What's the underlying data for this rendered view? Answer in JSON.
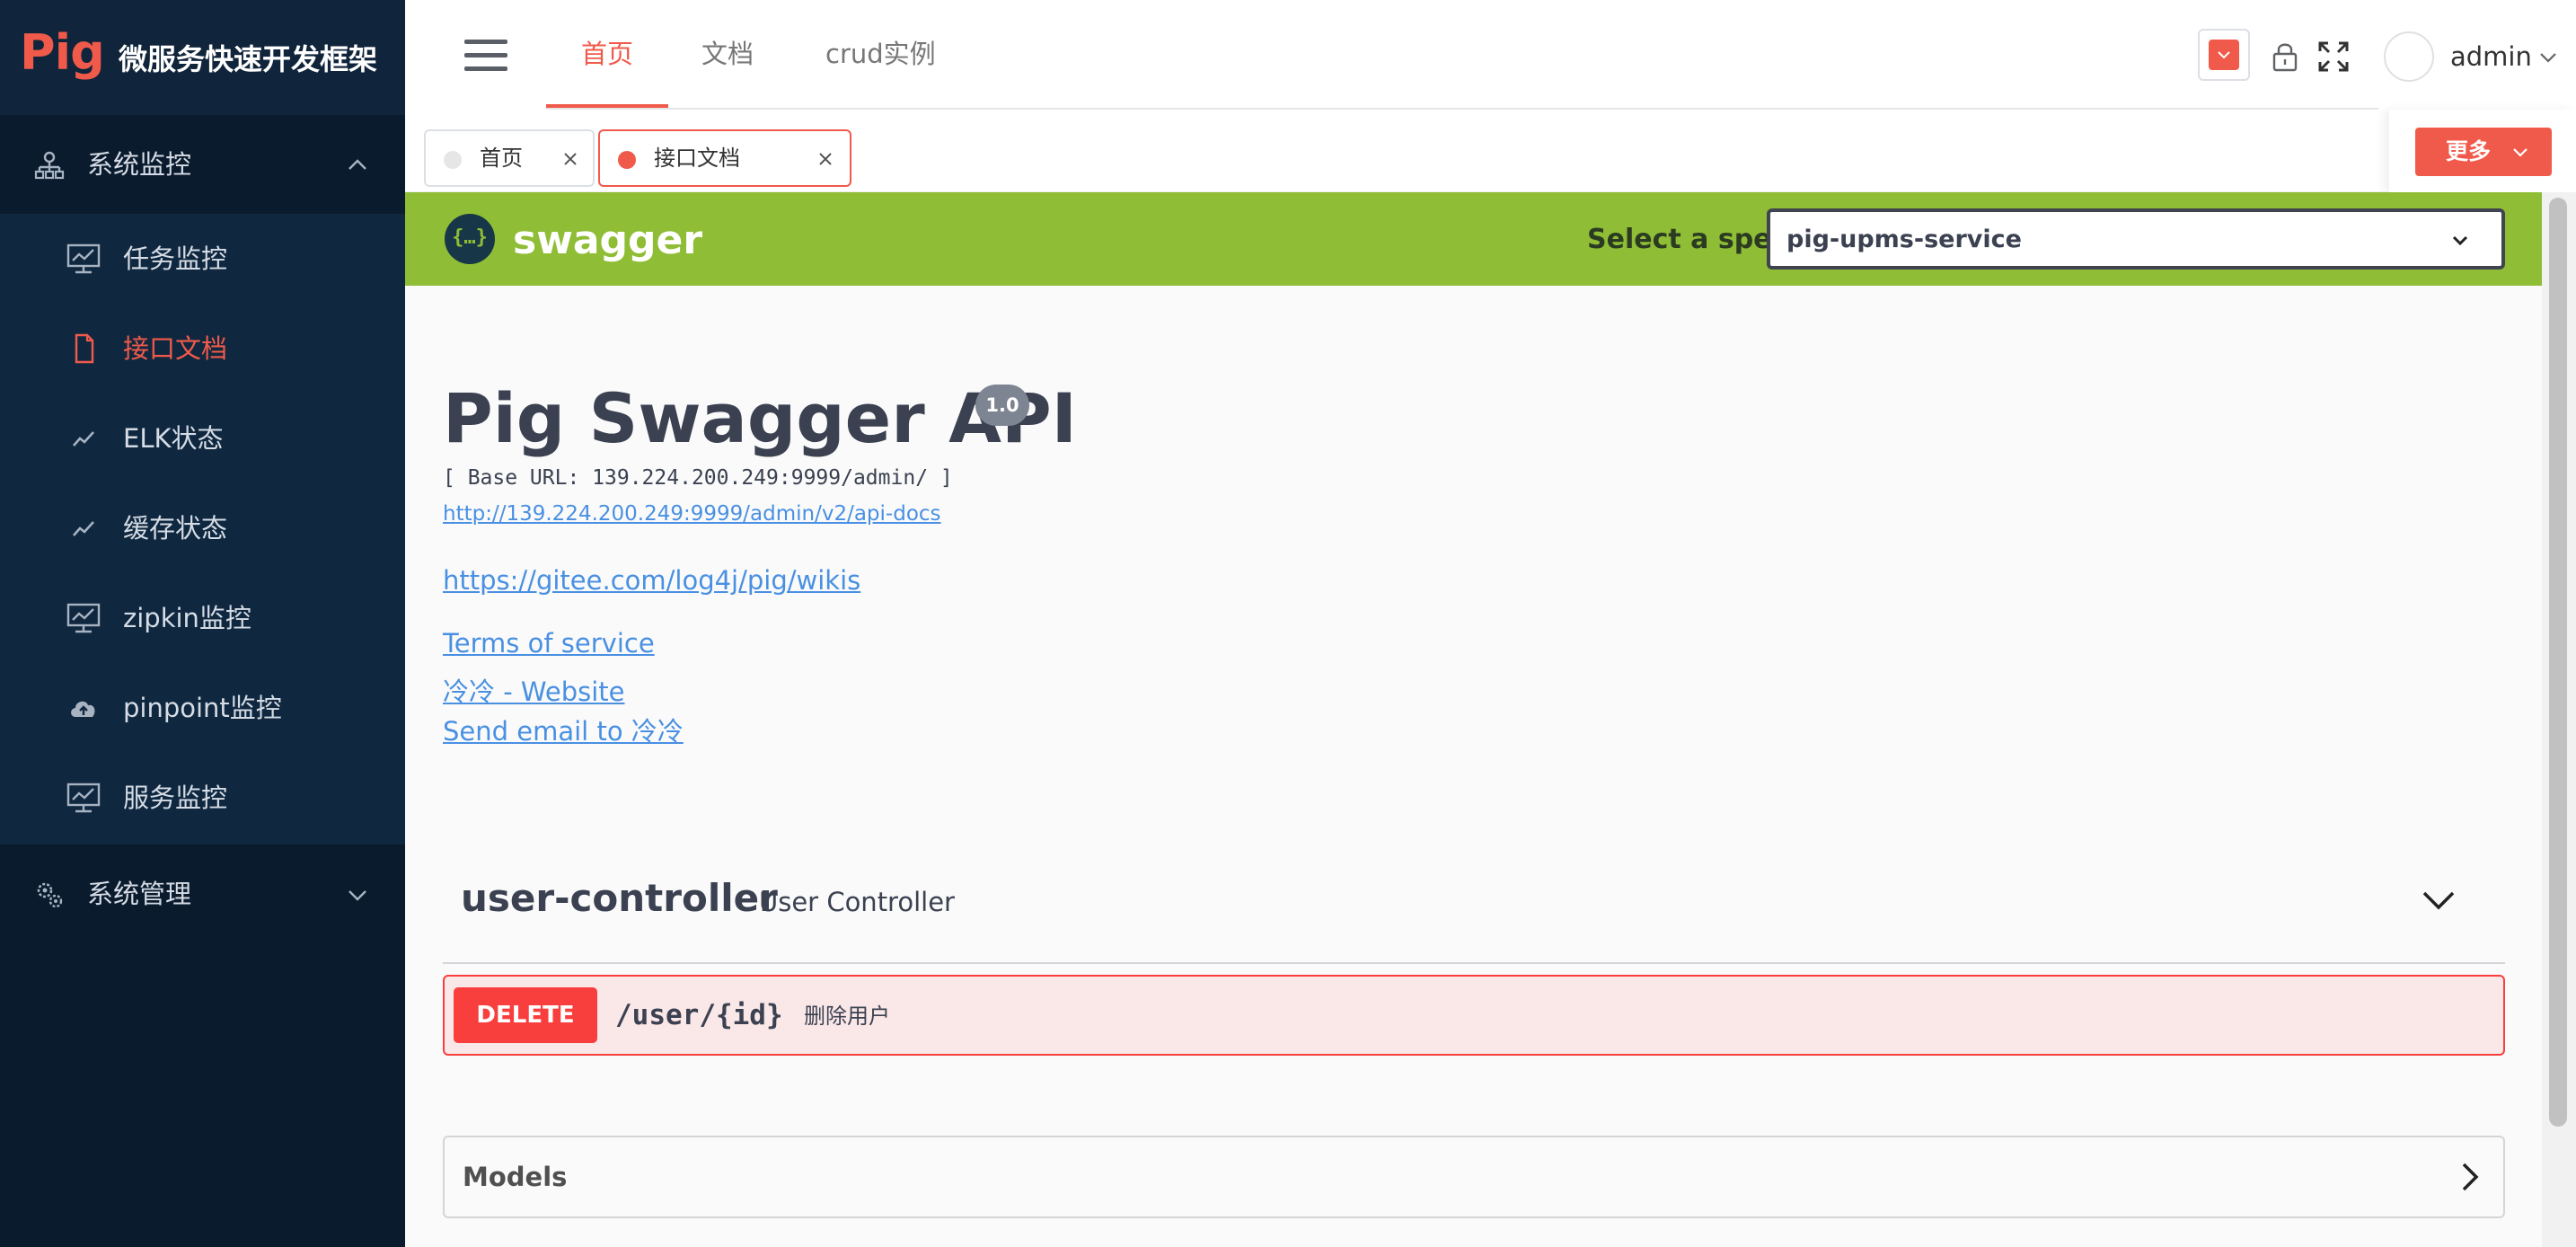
{
  "brand": {
    "logo": "Pig",
    "title": "微服务快速开发框架"
  },
  "sidebar": {
    "groups": [
      {
        "label": "系统监控",
        "icon": "sitemap-icon",
        "expanded": true,
        "items": [
          {
            "label": "任务监控",
            "icon": "monitor-icon",
            "active": false
          },
          {
            "label": "接口文档",
            "icon": "document-icon",
            "active": true
          },
          {
            "label": "ELK状态",
            "icon": "line-chart-icon",
            "active": false
          },
          {
            "label": "缓存状态",
            "icon": "line-chart-icon",
            "active": false
          },
          {
            "label": "zipkin监控",
            "icon": "monitor-icon",
            "active": false
          },
          {
            "label": "pinpoint监控",
            "icon": "cloud-upload-icon",
            "active": false
          },
          {
            "label": "服务监控",
            "icon": "monitor-icon",
            "active": false
          }
        ]
      },
      {
        "label": "系统管理",
        "icon": "gears-icon",
        "expanded": false
      }
    ]
  },
  "header": {
    "nav": [
      {
        "label": "首页",
        "active": true
      },
      {
        "label": "文档",
        "active": false
      },
      {
        "label": "crud实例",
        "active": false
      }
    ],
    "theme_color": "#f05a4a",
    "user": {
      "name": "admin"
    }
  },
  "tabs": {
    "items": [
      {
        "label": "首页",
        "active": false
      },
      {
        "label": "接口文档",
        "active": true
      }
    ],
    "more_label": "更多"
  },
  "swagger": {
    "brand": "swagger",
    "logo_glyph": "{…}",
    "spec_label": "Select a spec",
    "spec_value": "pig-upms-service",
    "title": "Pig Swagger API",
    "version": "1.0",
    "base_url": "[ Base URL: 139.224.200.249:9999/admin/ ]",
    "api_docs_link": "http://139.224.200.249:9999/admin/v2/api-docs",
    "wiki_link": "https://gitee.com/log4j/pig/wikis",
    "terms_link": "Terms of service",
    "website_link": "冷冷 - Website",
    "email_link": "Send email to 冷冷",
    "controller": {
      "name": "user-controller",
      "description": "User Controller",
      "operations": [
        {
          "method": "DELETE",
          "path": "/user/{id}",
          "summary": "删除用户"
        }
      ]
    },
    "models_label": "Models"
  }
}
